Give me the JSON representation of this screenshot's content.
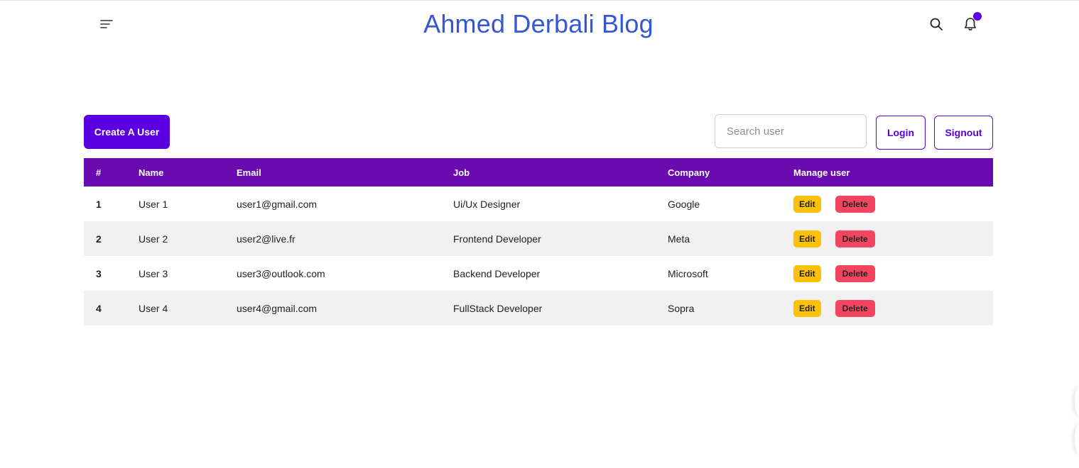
{
  "header": {
    "title": "Ahmed Derbali Blog",
    "menu_icon": "menu-icon",
    "search_icon": "search-icon",
    "notification_icon": "bell-icon",
    "title_color": "#3557d6",
    "accent_color": "#5a00e0"
  },
  "toolbar": {
    "create_label": "Create A User",
    "search_placeholder": "Search user",
    "search_value": "",
    "login_label": "Login",
    "signout_label": "Signout"
  },
  "table": {
    "header_color": "#6a0bb0",
    "columns": [
      "#",
      "Name",
      "Email",
      "Job",
      "Company",
      "Manage user"
    ],
    "rows": [
      {
        "num": "1",
        "name": "User 1",
        "email": "user1@gmail.com",
        "job": "Ui/Ux Designer",
        "company": "Google",
        "edit": "Edit",
        "delete": "Delete"
      },
      {
        "num": "2",
        "name": "User 2",
        "email": "user2@live.fr",
        "job": "Frontend Developer",
        "company": "Meta",
        "edit": "Edit",
        "delete": "Delete"
      },
      {
        "num": "3",
        "name": "User 3",
        "email": "user3@outlook.com",
        "job": "Backend Developer",
        "company": "Microsoft",
        "edit": "Edit",
        "delete": "Delete"
      },
      {
        "num": "4",
        "name": "User 4",
        "email": "user4@gmail.com",
        "job": "FullStack Developer",
        "company": "Sopra",
        "edit": "Edit",
        "delete": "Delete"
      }
    ],
    "edit_color": "#ffc107",
    "delete_color": "#f44560"
  }
}
